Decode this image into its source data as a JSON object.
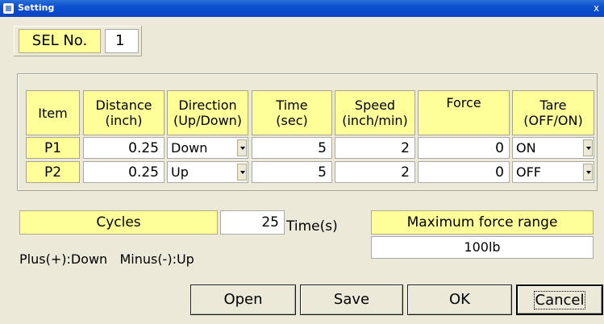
{
  "window": {
    "title": "Setting",
    "close_glyph": "x"
  },
  "sel": {
    "label": "SEL No.",
    "value": "1"
  },
  "table": {
    "headers": [
      {
        "line1": "Item",
        "line2": ""
      },
      {
        "line1": "Distance",
        "line2": "(inch)"
      },
      {
        "line1": "Direction",
        "line2": "(Up/Down)"
      },
      {
        "line1": "Time",
        "line2": "(sec)"
      },
      {
        "line1": "Speed",
        "line2": "(inch/min)"
      },
      {
        "line1": "Force",
        "line2": ""
      },
      {
        "line1": "Tare",
        "line2": "(OFF/ON)"
      }
    ],
    "rows": [
      {
        "item": "P1",
        "distance": "0.25",
        "direction": "Down",
        "time": "5",
        "speed": "2",
        "force": "0",
        "tare": "ON"
      },
      {
        "item": "P2",
        "distance": "0.25",
        "direction": "Up",
        "time": "5",
        "speed": "2",
        "force": "0",
        "tare": "OFF"
      }
    ]
  },
  "cycles": {
    "label": "Cycles",
    "value": "25",
    "unit": "Time(s)"
  },
  "hint": "Plus(+):Down   Minus(-):Up",
  "max_force": {
    "label": "Maximum force range",
    "value": "100lb"
  },
  "buttons": {
    "open": "Open",
    "save": "Save",
    "ok": "OK",
    "cancel": "Cancel"
  }
}
